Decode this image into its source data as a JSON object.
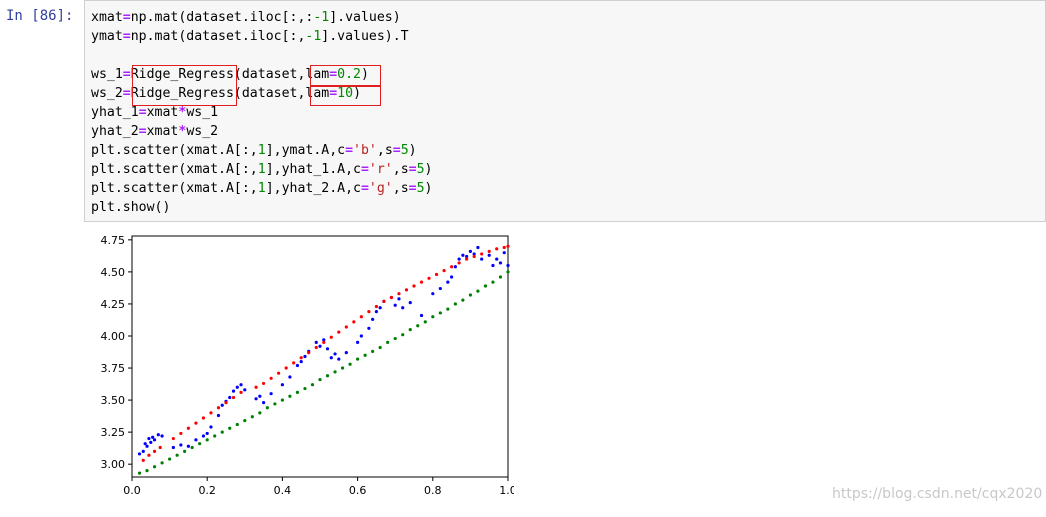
{
  "notebook": {
    "prompt": "In  [86]:",
    "lines": [
      [
        {
          "t": "xmat"
        },
        {
          "t": "=",
          "c": "op"
        },
        {
          "t": "np.mat(dataset.iloc[:,:"
        },
        {
          "t": "-1",
          "c": "num"
        },
        {
          "t": "].values)"
        }
      ],
      [
        {
          "t": "ymat"
        },
        {
          "t": "=",
          "c": "op"
        },
        {
          "t": "np.mat(dataset.iloc[:,"
        },
        {
          "t": "-1",
          "c": "num"
        },
        {
          "t": "].values).T"
        }
      ],
      [],
      [
        {
          "t": "ws_1"
        },
        {
          "t": "=",
          "c": "op"
        },
        {
          "t": "Ridge_Regress(dataset,lam"
        },
        {
          "t": "=",
          "c": "op"
        },
        {
          "t": "0.2",
          "c": "num"
        },
        {
          "t": ")"
        }
      ],
      [
        {
          "t": "ws_2"
        },
        {
          "t": "=",
          "c": "op"
        },
        {
          "t": "Ridge_Regress(dataset,lam"
        },
        {
          "t": "=",
          "c": "op"
        },
        {
          "t": "10",
          "c": "num"
        },
        {
          "t": ")"
        }
      ],
      [
        {
          "t": "yhat_1"
        },
        {
          "t": "=",
          "c": "op"
        },
        {
          "t": "xmat"
        },
        {
          "t": "*",
          "c": "op"
        },
        {
          "t": "ws_1"
        }
      ],
      [
        {
          "t": "yhat_2"
        },
        {
          "t": "=",
          "c": "op"
        },
        {
          "t": "xmat"
        },
        {
          "t": "*",
          "c": "op"
        },
        {
          "t": "ws_2"
        }
      ],
      [
        {
          "t": "plt.scatter(xmat.A[:,"
        },
        {
          "t": "1",
          "c": "num"
        },
        {
          "t": "],ymat.A,c"
        },
        {
          "t": "=",
          "c": "op"
        },
        {
          "t": "'b'",
          "c": "str"
        },
        {
          "t": ",s"
        },
        {
          "t": "=",
          "c": "op"
        },
        {
          "t": "5",
          "c": "num"
        },
        {
          "t": ")"
        }
      ],
      [
        {
          "t": "plt.scatter(xmat.A[:,"
        },
        {
          "t": "1",
          "c": "num"
        },
        {
          "t": "],yhat_1.A,c"
        },
        {
          "t": "=",
          "c": "op"
        },
        {
          "t": "'r'",
          "c": "str"
        },
        {
          "t": ",s"
        },
        {
          "t": "=",
          "c": "op"
        },
        {
          "t": "5",
          "c": "num"
        },
        {
          "t": ")"
        }
      ],
      [
        {
          "t": "plt.scatter(xmat.A[:,"
        },
        {
          "t": "1",
          "c": "num"
        },
        {
          "t": "],yhat_2.A,c"
        },
        {
          "t": "=",
          "c": "op"
        },
        {
          "t": "'g'",
          "c": "str"
        },
        {
          "t": ",s"
        },
        {
          "t": "=",
          "c": "op"
        },
        {
          "t": "5",
          "c": "num"
        },
        {
          "t": ")"
        }
      ],
      [
        {
          "t": "plt.show()"
        }
      ]
    ],
    "colors": {
      "keyword_op": "#aa22ff",
      "number": "#008800",
      "string": "#ba2121",
      "highlight_box": "#e02020"
    }
  },
  "chart_data": {
    "type": "scatter",
    "xlim": [
      0.0,
      1.0
    ],
    "ylim": [
      2.9,
      4.78
    ],
    "xticks": [
      "0.0",
      "0.2",
      "0.4",
      "0.6",
      "0.8",
      "1.0"
    ],
    "yticks": [
      "3.00",
      "3.25",
      "3.50",
      "3.75",
      "4.00",
      "4.25",
      "4.50",
      "4.75"
    ],
    "xtick_values": [
      0.0,
      0.2,
      0.4,
      0.6,
      0.8,
      1.0
    ],
    "ytick_values": [
      3.0,
      3.25,
      3.5,
      3.75,
      4.0,
      4.25,
      4.5,
      4.75
    ],
    "series": [
      {
        "color": "#0000ff",
        "points": [
          [
            0.02,
            3.08
          ],
          [
            0.03,
            3.1
          ],
          [
            0.035,
            3.16
          ],
          [
            0.04,
            3.14
          ],
          [
            0.045,
            3.2
          ],
          [
            0.05,
            3.17
          ],
          [
            0.055,
            3.21
          ],
          [
            0.06,
            3.19
          ],
          [
            0.07,
            3.23
          ],
          [
            0.08,
            3.22
          ],
          [
            0.11,
            3.13
          ],
          [
            0.13,
            3.15
          ],
          [
            0.15,
            3.14
          ],
          [
            0.17,
            3.19
          ],
          [
            0.19,
            3.22
          ],
          [
            0.2,
            3.24
          ],
          [
            0.21,
            3.29
          ],
          [
            0.23,
            3.38
          ],
          [
            0.24,
            3.46
          ],
          [
            0.25,
            3.49
          ],
          [
            0.26,
            3.52
          ],
          [
            0.27,
            3.57
          ],
          [
            0.28,
            3.6
          ],
          [
            0.29,
            3.62
          ],
          [
            0.3,
            3.58
          ],
          [
            0.33,
            3.51
          ],
          [
            0.34,
            3.53
          ],
          [
            0.35,
            3.48
          ],
          [
            0.37,
            3.55
          ],
          [
            0.4,
            3.62
          ],
          [
            0.42,
            3.68
          ],
          [
            0.44,
            3.77
          ],
          [
            0.45,
            3.8
          ],
          [
            0.46,
            3.84
          ],
          [
            0.47,
            3.88
          ],
          [
            0.49,
            3.95
          ],
          [
            0.5,
            3.92
          ],
          [
            0.51,
            3.97
          ],
          [
            0.52,
            3.9
          ],
          [
            0.53,
            3.83
          ],
          [
            0.54,
            3.86
          ],
          [
            0.55,
            3.82
          ],
          [
            0.57,
            3.87
          ],
          [
            0.6,
            3.95
          ],
          [
            0.61,
            4.0
          ],
          [
            0.63,
            4.06
          ],
          [
            0.64,
            4.13
          ],
          [
            0.65,
            4.19
          ],
          [
            0.66,
            4.22
          ],
          [
            0.67,
            4.27
          ],
          [
            0.69,
            4.3
          ],
          [
            0.7,
            4.24
          ],
          [
            0.71,
            4.29
          ],
          [
            0.72,
            4.22
          ],
          [
            0.74,
            4.26
          ],
          [
            0.77,
            4.16
          ],
          [
            0.8,
            4.33
          ],
          [
            0.82,
            4.37
          ],
          [
            0.84,
            4.42
          ],
          [
            0.85,
            4.46
          ],
          [
            0.86,
            4.54
          ],
          [
            0.87,
            4.6
          ],
          [
            0.88,
            4.63
          ],
          [
            0.89,
            4.62
          ],
          [
            0.9,
            4.66
          ],
          [
            0.91,
            4.64
          ],
          [
            0.92,
            4.69
          ],
          [
            0.93,
            4.6
          ],
          [
            0.95,
            4.63
          ],
          [
            0.96,
            4.55
          ],
          [
            0.97,
            4.6
          ],
          [
            0.98,
            4.57
          ],
          [
            0.99,
            4.65
          ],
          [
            1.0,
            4.55
          ]
        ]
      },
      {
        "color": "#ff0000",
        "points": [
          [
            0.03,
            3.03
          ],
          [
            0.045,
            3.07
          ],
          [
            0.06,
            3.1
          ],
          [
            0.075,
            3.13
          ],
          [
            0.11,
            3.2
          ],
          [
            0.13,
            3.24
          ],
          [
            0.15,
            3.28
          ],
          [
            0.17,
            3.32
          ],
          [
            0.19,
            3.36
          ],
          [
            0.21,
            3.4
          ],
          [
            0.23,
            3.44
          ],
          [
            0.25,
            3.48
          ],
          [
            0.27,
            3.52
          ],
          [
            0.29,
            3.56
          ],
          [
            0.33,
            3.6
          ],
          [
            0.35,
            3.63
          ],
          [
            0.37,
            3.67
          ],
          [
            0.39,
            3.71
          ],
          [
            0.41,
            3.75
          ],
          [
            0.43,
            3.79
          ],
          [
            0.45,
            3.83
          ],
          [
            0.47,
            3.87
          ],
          [
            0.49,
            3.91
          ],
          [
            0.51,
            3.95
          ],
          [
            0.53,
            3.99
          ],
          [
            0.55,
            4.03
          ],
          [
            0.57,
            4.07
          ],
          [
            0.59,
            4.11
          ],
          [
            0.61,
            4.15
          ],
          [
            0.63,
            4.19
          ],
          [
            0.65,
            4.23
          ],
          [
            0.67,
            4.27
          ],
          [
            0.69,
            4.3
          ],
          [
            0.71,
            4.33
          ],
          [
            0.73,
            4.36
          ],
          [
            0.75,
            4.39
          ],
          [
            0.77,
            4.42
          ],
          [
            0.79,
            4.45
          ],
          [
            0.81,
            4.48
          ],
          [
            0.83,
            4.51
          ],
          [
            0.85,
            4.54
          ],
          [
            0.87,
            4.57
          ],
          [
            0.89,
            4.6
          ],
          [
            0.91,
            4.62
          ],
          [
            0.93,
            4.64
          ],
          [
            0.95,
            4.66
          ],
          [
            0.97,
            4.68
          ],
          [
            0.99,
            4.69
          ],
          [
            1.0,
            4.7
          ]
        ]
      },
      {
        "color": "#008000",
        "points": [
          [
            0.02,
            2.93
          ],
          [
            0.04,
            2.95
          ],
          [
            0.06,
            2.98
          ],
          [
            0.08,
            3.01
          ],
          [
            0.1,
            3.04
          ],
          [
            0.12,
            3.07
          ],
          [
            0.14,
            3.1
          ],
          [
            0.16,
            3.13
          ],
          [
            0.18,
            3.16
          ],
          [
            0.2,
            3.19
          ],
          [
            0.22,
            3.22
          ],
          [
            0.24,
            3.25
          ],
          [
            0.26,
            3.28
          ],
          [
            0.28,
            3.31
          ],
          [
            0.3,
            3.34
          ],
          [
            0.32,
            3.37
          ],
          [
            0.34,
            3.4
          ],
          [
            0.36,
            3.44
          ],
          [
            0.38,
            3.47
          ],
          [
            0.4,
            3.5
          ],
          [
            0.42,
            3.53
          ],
          [
            0.44,
            3.56
          ],
          [
            0.46,
            3.59
          ],
          [
            0.48,
            3.62
          ],
          [
            0.5,
            3.66
          ],
          [
            0.52,
            3.69
          ],
          [
            0.54,
            3.72
          ],
          [
            0.56,
            3.75
          ],
          [
            0.58,
            3.78
          ],
          [
            0.6,
            3.82
          ],
          [
            0.62,
            3.85
          ],
          [
            0.64,
            3.88
          ],
          [
            0.66,
            3.91
          ],
          [
            0.68,
            3.95
          ],
          [
            0.7,
            3.98
          ],
          [
            0.72,
            4.01
          ],
          [
            0.74,
            4.05
          ],
          [
            0.76,
            4.08
          ],
          [
            0.78,
            4.11
          ],
          [
            0.8,
            4.15
          ],
          [
            0.82,
            4.18
          ],
          [
            0.84,
            4.21
          ],
          [
            0.86,
            4.25
          ],
          [
            0.88,
            4.28
          ],
          [
            0.9,
            4.32
          ],
          [
            0.92,
            4.35
          ],
          [
            0.94,
            4.39
          ],
          [
            0.96,
            4.42
          ],
          [
            0.98,
            4.46
          ],
          [
            1.0,
            4.5
          ]
        ]
      }
    ]
  },
  "watermark": "https://blog.csdn.net/cqx2020"
}
